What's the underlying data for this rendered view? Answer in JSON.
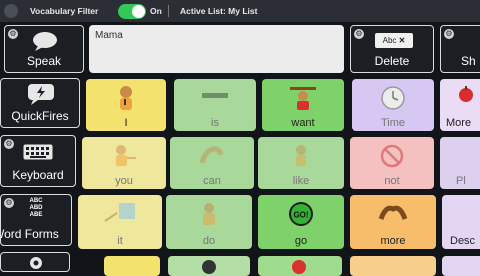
{
  "topbar": {
    "vocab_filter_label": "Vocabulary Filter",
    "toggle_state": "On",
    "active_list": "Active List: My List"
  },
  "toolbar": {
    "speak": "Speak",
    "delete": "Delete",
    "delete_key_glyph": "Abc",
    "delete_x": "✕",
    "share_partial": "Sh"
  },
  "message_bar": {
    "text": "Mama"
  },
  "sidebar": {
    "quickfires": "QuickFires",
    "keyboard": "Keyboard",
    "word_forms": "Word Forms",
    "abc_tiles": [
      "ABC",
      "ABD",
      "ABE"
    ]
  },
  "grid": {
    "row1": [
      "I",
      "is",
      "want",
      "Time",
      "More"
    ],
    "row2": [
      "you",
      "can",
      "like",
      "not",
      "Pl"
    ],
    "row3": [
      "it",
      "do",
      "go",
      "more",
      "Desc"
    ]
  },
  "go_sign_text": "GO!",
  "colors": {
    "toggle_on": "#34c759",
    "pronoun_yellow": "#f3e36e",
    "verb_green": "#7fd16a",
    "question_purple": "#d6c8f2",
    "adjective_orange": "#f7bd6a"
  }
}
